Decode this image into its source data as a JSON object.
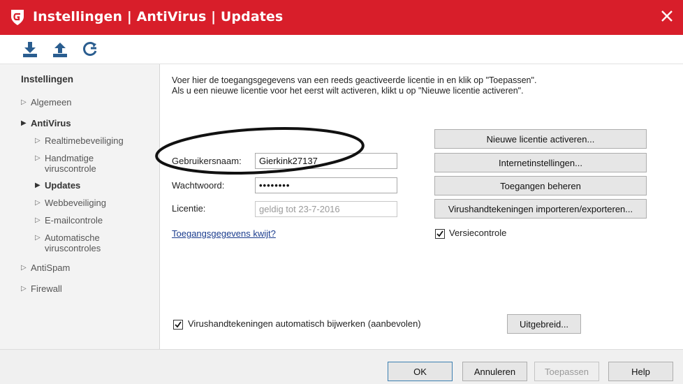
{
  "window": {
    "title": "Instellingen | AntiVirus | Updates",
    "brand_color": "#d81e2a"
  },
  "toolbar": {
    "icons": [
      "download-icon",
      "upload-icon",
      "refresh-icon"
    ]
  },
  "sidebar": {
    "heading": "Instellingen",
    "items": [
      {
        "label": "Algemeen"
      },
      {
        "label": "AntiVirus"
      },
      {
        "label": "Realtimebeveiliging"
      },
      {
        "label": "Handmatige\nviruscontrole"
      },
      {
        "label": "Updates"
      },
      {
        "label": "Webbeveiliging"
      },
      {
        "label": "E-mailcontrole"
      },
      {
        "label": "Automatische\nviruscontroles"
      },
      {
        "label": "AntiSpam"
      },
      {
        "label": "Firewall"
      }
    ]
  },
  "main": {
    "intro_line1": "Voer hier de toegangsgegevens van een reeds geactiveerde licentie in en klik op \"Toepassen\".",
    "intro_line2": "Als u een nieuwe licentie voor het eerst wilt activeren, klikt u op \"Nieuwe licentie activeren\".",
    "username_label": "Gebruikersnaam:",
    "username_value": "Gierkink27137",
    "password_label": "Wachtwoord:",
    "password_value": "••••••••",
    "license_label": "Licentie:",
    "license_value": "geldig tot 23-7-2016",
    "forgot_link": "Toegangsgegevens kwijt?",
    "btn_new_license": "Nieuwe licentie activeren...",
    "btn_internet": "Internetinstellingen...",
    "btn_access": "Toegangen beheren",
    "btn_import_export": "Virushandtekeningen importeren/exporteren...",
    "version_check_label": "Versiecontrole",
    "version_check_checked": true,
    "auto_update_label": "Virushandtekeningen automatisch bijwerken (aanbevolen)",
    "auto_update_checked": true,
    "btn_advanced": "Uitgebreid..."
  },
  "footer": {
    "ok": "OK",
    "cancel": "Annuleren",
    "apply": "Toepassen",
    "help": "Help"
  }
}
